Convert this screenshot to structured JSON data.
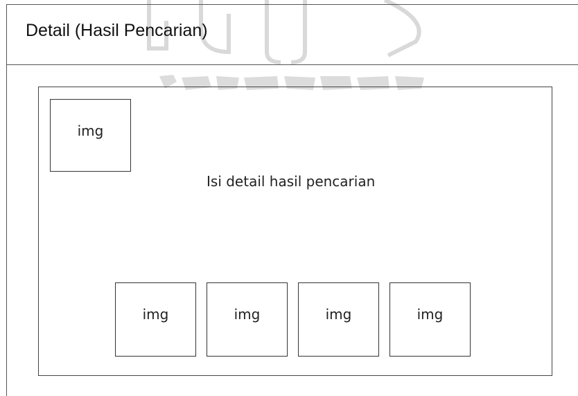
{
  "header": {
    "title": "Detail (Hasil Pencarian)"
  },
  "content": {
    "detail_text": "Isi detail hasil pencarian",
    "main_image_label": "img",
    "thumbnails": [
      {
        "label": "img"
      },
      {
        "label": "img"
      },
      {
        "label": "img"
      },
      {
        "label": "img"
      }
    ]
  },
  "colors": {
    "border": "#444444",
    "watermark": "#dcdcdc",
    "background": "#ffffff"
  }
}
